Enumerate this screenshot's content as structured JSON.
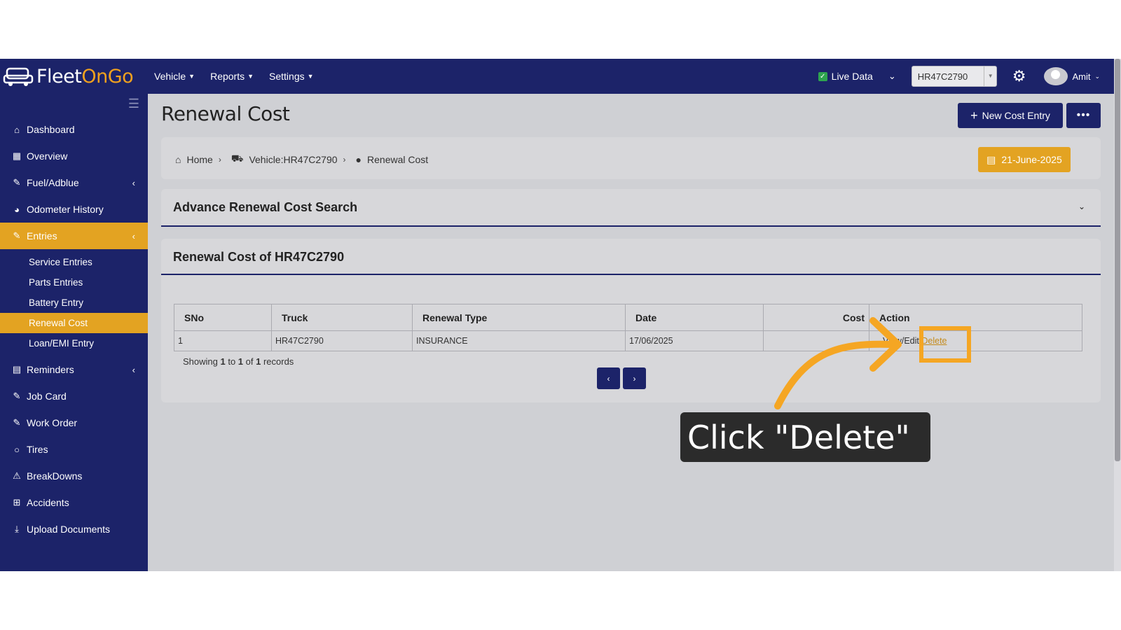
{
  "brand": {
    "part1": "Fleet",
    "part2": "OnGo"
  },
  "topnav": {
    "items": [
      {
        "label": "Vehicle"
      },
      {
        "label": "Reports"
      },
      {
        "label": "Settings"
      }
    ],
    "live_data_label": "Live Data",
    "vehicle_select_value": "HR47C2790",
    "user_name": "Amit"
  },
  "sidebar": {
    "items": [
      {
        "label": "Dashboard",
        "icon": "home-icon"
      },
      {
        "label": "Overview",
        "icon": "overview-icon"
      },
      {
        "label": "Fuel/Adblue",
        "icon": "edit-icon"
      },
      {
        "label": "Odometer History",
        "icon": "gauge-icon"
      },
      {
        "label": "Entries",
        "icon": "edit-icon"
      },
      {
        "label": "Reminders",
        "icon": "calendar-icon"
      },
      {
        "label": "Job Card",
        "icon": "edit-icon"
      },
      {
        "label": "Work Order",
        "icon": "edit-icon"
      },
      {
        "label": "Tires",
        "icon": "circle-icon"
      },
      {
        "label": "BreakDowns",
        "icon": "warning-icon"
      },
      {
        "label": "Accidents",
        "icon": "plus-square-icon"
      },
      {
        "label": "Upload Documents",
        "icon": "download-icon"
      }
    ],
    "entries_sub": [
      {
        "label": "Service Entries"
      },
      {
        "label": "Parts Entries"
      },
      {
        "label": "Battery Entry"
      },
      {
        "label": "Renewal Cost"
      },
      {
        "label": "Loan/EMI Entry"
      }
    ]
  },
  "page": {
    "title": "Renewal Cost",
    "new_button": "New Cost Entry",
    "more_button": "•••",
    "breadcrumb": [
      "Home",
      "Vehicle:HR47C2790",
      "Renewal Cost"
    ],
    "date_button": "21-June-2025"
  },
  "advanced_search": {
    "title": "Advance Renewal Cost Search"
  },
  "results": {
    "title": "Renewal Cost of HR47C2790",
    "columns": [
      "SNo",
      "Truck",
      "Renewal Type",
      "Date",
      "Cost",
      "Action"
    ],
    "rows": [
      {
        "sno": "1",
        "truck": "HR47C2790",
        "renewal_type": "INSURANCE",
        "date": "17/06/2025",
        "cost": "",
        "action_prefix": "View/Edit/",
        "action_delete": "Delete"
      }
    ],
    "showing_prefix": "Showing ",
    "showing_from": "1",
    "showing_to_word": " to ",
    "showing_to": "1",
    "showing_of_word": " of ",
    "showing_total": "1",
    "showing_suffix": " records",
    "prev_label": "‹",
    "next_label": "›"
  },
  "annotation": {
    "text": "Click \"Delete\""
  },
  "colors": {
    "navy": "#1c2369",
    "accent": "#e3a322",
    "highlight": "#f5a623"
  }
}
